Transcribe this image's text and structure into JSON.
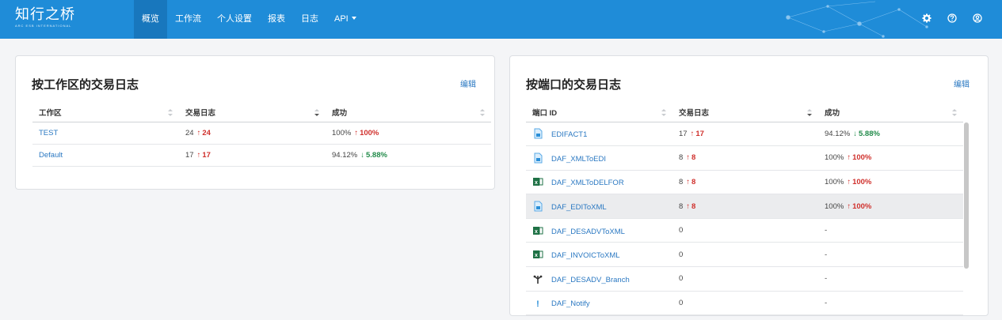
{
  "brand": {
    "name_cn": "知行之桥",
    "name_en": "ARC ESB INTERNATIONAL"
  },
  "nav": {
    "items": [
      {
        "label": "概览"
      },
      {
        "label": "工作流"
      },
      {
        "label": "个人设置"
      },
      {
        "label": "报表"
      },
      {
        "label": "日志"
      },
      {
        "label": "API"
      }
    ],
    "active_index": 0
  },
  "top_icons": [
    "gear-icon",
    "help-icon",
    "user-icon"
  ],
  "workspace_card": {
    "title": "按工作区的交易日志",
    "edit_label": "编辑",
    "columns": [
      "工作区",
      "交易日志",
      "成功"
    ],
    "rows": [
      {
        "name": "TEST",
        "log_count": "24",
        "log_delta": "24",
        "log_dir": "up",
        "success": "100%",
        "success_delta": "100%",
        "success_dir": "up"
      },
      {
        "name": "Default",
        "log_count": "17",
        "log_delta": "17",
        "log_dir": "up",
        "success": "94.12%",
        "success_delta": "5.88%",
        "success_dir": "down"
      }
    ]
  },
  "port_card": {
    "title": "按端口的交易日志",
    "edit_label": "编辑",
    "columns": [
      "端口 ID",
      "交易日志",
      "成功"
    ],
    "rows": [
      {
        "icon": "edifact-icon",
        "name": "EDIFACT1",
        "log_count": "17",
        "log_delta": "17",
        "success": "94.12%",
        "success_delta": "5.88%",
        "success_dir": "down"
      },
      {
        "icon": "xml-to-edi-icon",
        "name": "DAF_XMLToEDI",
        "log_count": "8",
        "log_delta": "8",
        "success": "100%",
        "success_delta": "100%",
        "success_dir": "up"
      },
      {
        "icon": "excel-icon",
        "name": "DAF_XMLToDELFOR",
        "log_count": "8",
        "log_delta": "8",
        "success": "100%",
        "success_delta": "100%",
        "success_dir": "up"
      },
      {
        "icon": "edi-to-xml-icon",
        "name": "DAF_EDIToXML",
        "log_count": "8",
        "log_delta": "8",
        "success": "100%",
        "success_delta": "100%",
        "success_dir": "up",
        "highlight": true
      },
      {
        "icon": "excel-icon",
        "name": "DAF_DESADVToXML",
        "log_count": "0",
        "success": "-"
      },
      {
        "icon": "excel-icon",
        "name": "DAF_INVOICToXML",
        "log_count": "0",
        "success": "-"
      },
      {
        "icon": "branch-icon",
        "name": "DAF_DESADV_Branch",
        "log_count": "0",
        "success": "-"
      },
      {
        "icon": "notify-icon",
        "name": "DAF_Notify",
        "log_count": "0",
        "success": "-"
      }
    ]
  },
  "colors": {
    "nav_bg": "#1f8cd8",
    "nav_active": "#1877bd",
    "up": "#d0312d",
    "down": "#228b4a",
    "link": "#2a78c2"
  }
}
